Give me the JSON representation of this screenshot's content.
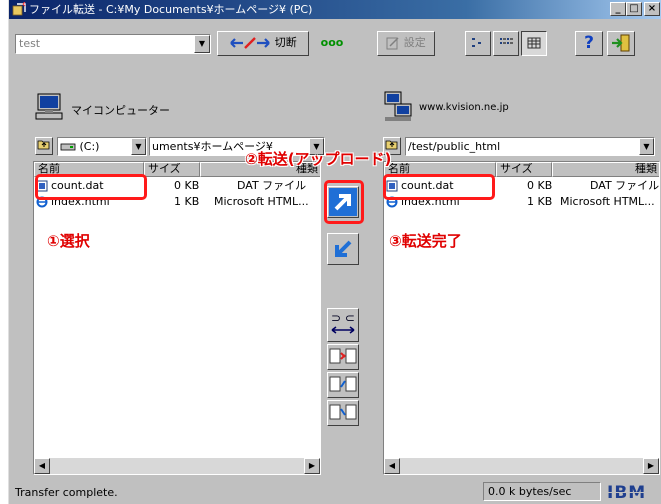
{
  "window": {
    "title": "ファイル転送 - C:¥My Documents¥ホームページ¥ (PC)",
    "buttons": {
      "minimize": "_",
      "maximize": "□",
      "close": "×"
    }
  },
  "toolbar": {
    "profile_value": "test",
    "disconnect_label": "切断",
    "activity": "ooo",
    "settings_label": "設定",
    "help_label": "?"
  },
  "local": {
    "header": "マイコンピューター",
    "up_icon": "up-folder-icon",
    "drive": "(C:)",
    "path": "uments¥ホームページ¥",
    "columns": {
      "name": "名前",
      "size": "サイズ",
      "type": "種類"
    },
    "files": [
      {
        "name": "count.dat",
        "size": "0 KB",
        "type": "DAT ファイル",
        "icon": "dat-file-icon"
      },
      {
        "name": "index.html",
        "size": "1 KB",
        "type": "Microsoft HTML...",
        "icon": "ie-file-icon"
      }
    ]
  },
  "remote": {
    "header": "www.kvision.ne.jp",
    "path": "/test/public_html",
    "columns": {
      "name": "名前",
      "size": "サイズ",
      "type": "種類"
    },
    "files": [
      {
        "name": "count.dat",
        "size": "0 KB",
        "type": "DAT ファイル",
        "icon": "dat-file-icon"
      },
      {
        "name": "index.html",
        "size": "1 KB",
        "type": "Microsoft HTML...",
        "icon": "ie-file-icon"
      }
    ]
  },
  "transfer_controls": {
    "upload_icon": "upload-arrow-icon",
    "download_icon": "download-arrow-icon",
    "mode_icon": "transfer-mode-icon",
    "mode_glyphs": "⊃ ⊂",
    "sync_icons": [
      "sync-both-icon",
      "sync-left-icon",
      "sync-right-icon"
    ]
  },
  "annotations": {
    "step1": "①選択",
    "step2": "②転送(アップロード)",
    "step3": "③転送完了"
  },
  "status": {
    "message": "Transfer complete.",
    "rate": "0.0 k bytes/sec",
    "brand": "IBM"
  },
  "colors": {
    "title_start": "#0a246a",
    "title_end": "#a6caf0",
    "face": "#c0c0c0",
    "annotation": "#e00000",
    "upload_arrow": "#1f6fd6"
  }
}
